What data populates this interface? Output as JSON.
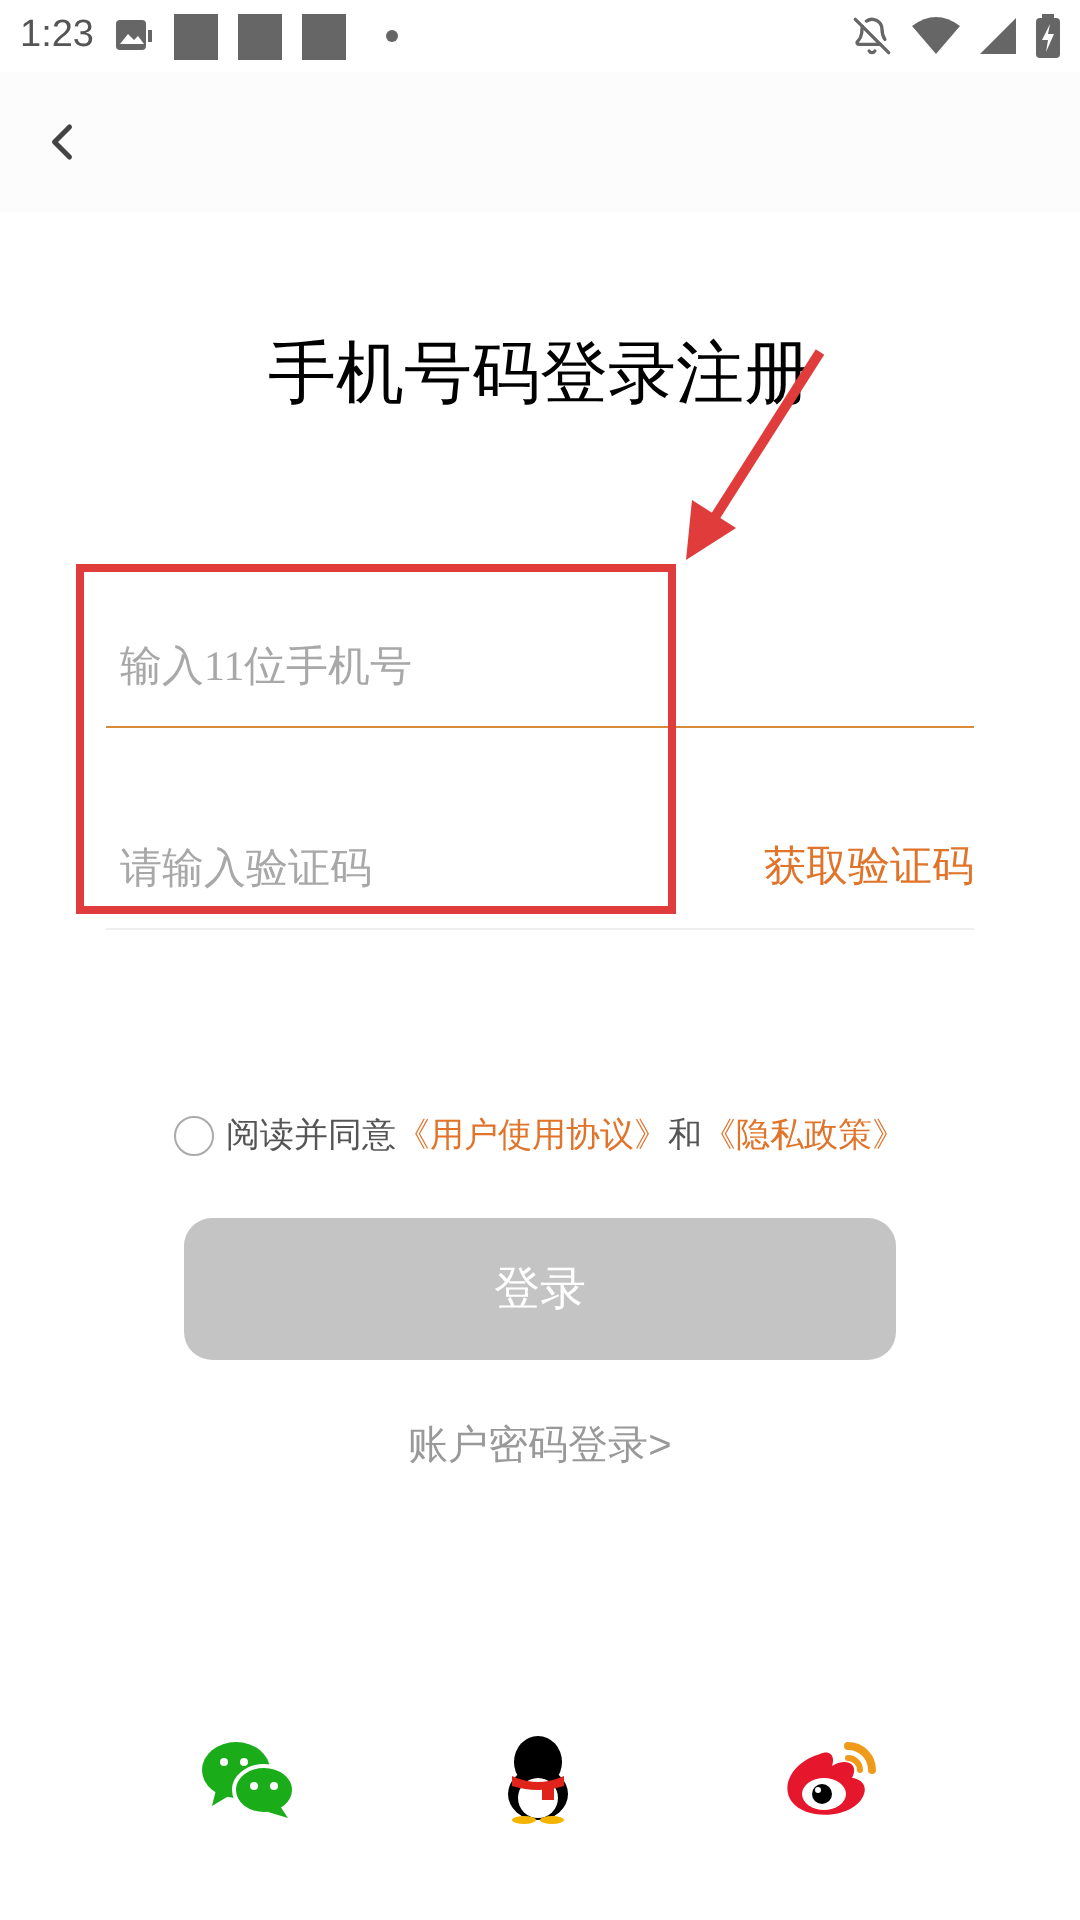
{
  "status_bar": {
    "time": "1:23"
  },
  "title": "手机号码登录注册",
  "phone_field": {
    "placeholder": "输入11位手机号"
  },
  "code_field": {
    "placeholder": "请输入验证码"
  },
  "get_code_button": "获取验证码",
  "agreement": {
    "checked": false,
    "parts": [
      {
        "kind": "text",
        "text": "阅读并同意"
      },
      {
        "kind": "link",
        "text": "《用户使用协议》"
      },
      {
        "kind": "text",
        "text": "和"
      },
      {
        "kind": "link",
        "text": "《隐私政策》"
      }
    ]
  },
  "login_button": {
    "label": "登录",
    "disabled": true
  },
  "password_login_link": "账户密码登录>",
  "social_logins": [
    {
      "kind": "chat"
    },
    {
      "kind": "penguin"
    },
    {
      "kind": "eye"
    }
  ]
}
